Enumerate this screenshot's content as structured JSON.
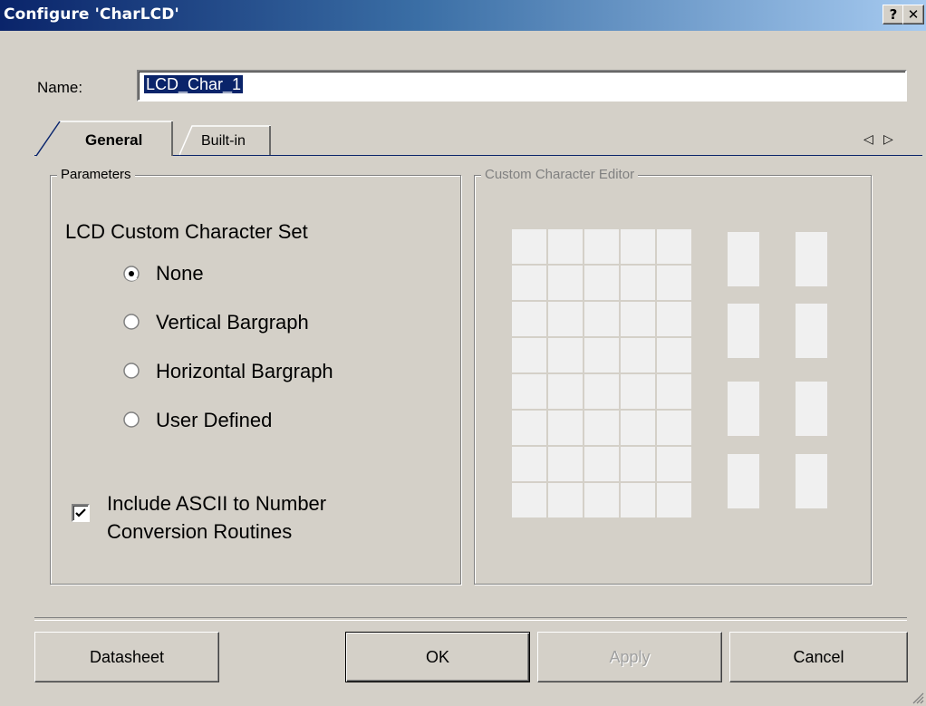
{
  "window": {
    "title": "Configure 'CharLCD'",
    "help_label": "?",
    "close_label": "✕"
  },
  "name": {
    "label": "Name:",
    "value": "LCD_Char_1"
  },
  "tabs": [
    {
      "label": "General",
      "active": true
    },
    {
      "label": "Built-in",
      "active": false
    }
  ],
  "tab_scroll": {
    "left": "◁",
    "right": "▷"
  },
  "parameters": {
    "title": "Parameters",
    "set_label": "LCD Custom Character Set",
    "options": [
      {
        "label": "None",
        "selected": true
      },
      {
        "label": "Vertical Bargraph",
        "selected": false
      },
      {
        "label": "Horizontal Bargraph",
        "selected": false
      },
      {
        "label": "User Defined",
        "selected": false
      }
    ],
    "checkbox": {
      "label_line1": "Include ASCII to Number",
      "label_line2": "Conversion Routines",
      "checked": true
    }
  },
  "editor": {
    "title": "Custom Character Editor",
    "grid_cols": 5,
    "grid_rows": 8
  },
  "buttons": {
    "datasheet": "Datasheet",
    "ok": "OK",
    "apply": "Apply",
    "cancel": "Cancel"
  },
  "colors": {
    "title_gradient_start": "#0a246a",
    "title_gradient_end": "#a6caf0",
    "selection": "#0a246a",
    "dialog_bg": "#d4d0c8"
  }
}
